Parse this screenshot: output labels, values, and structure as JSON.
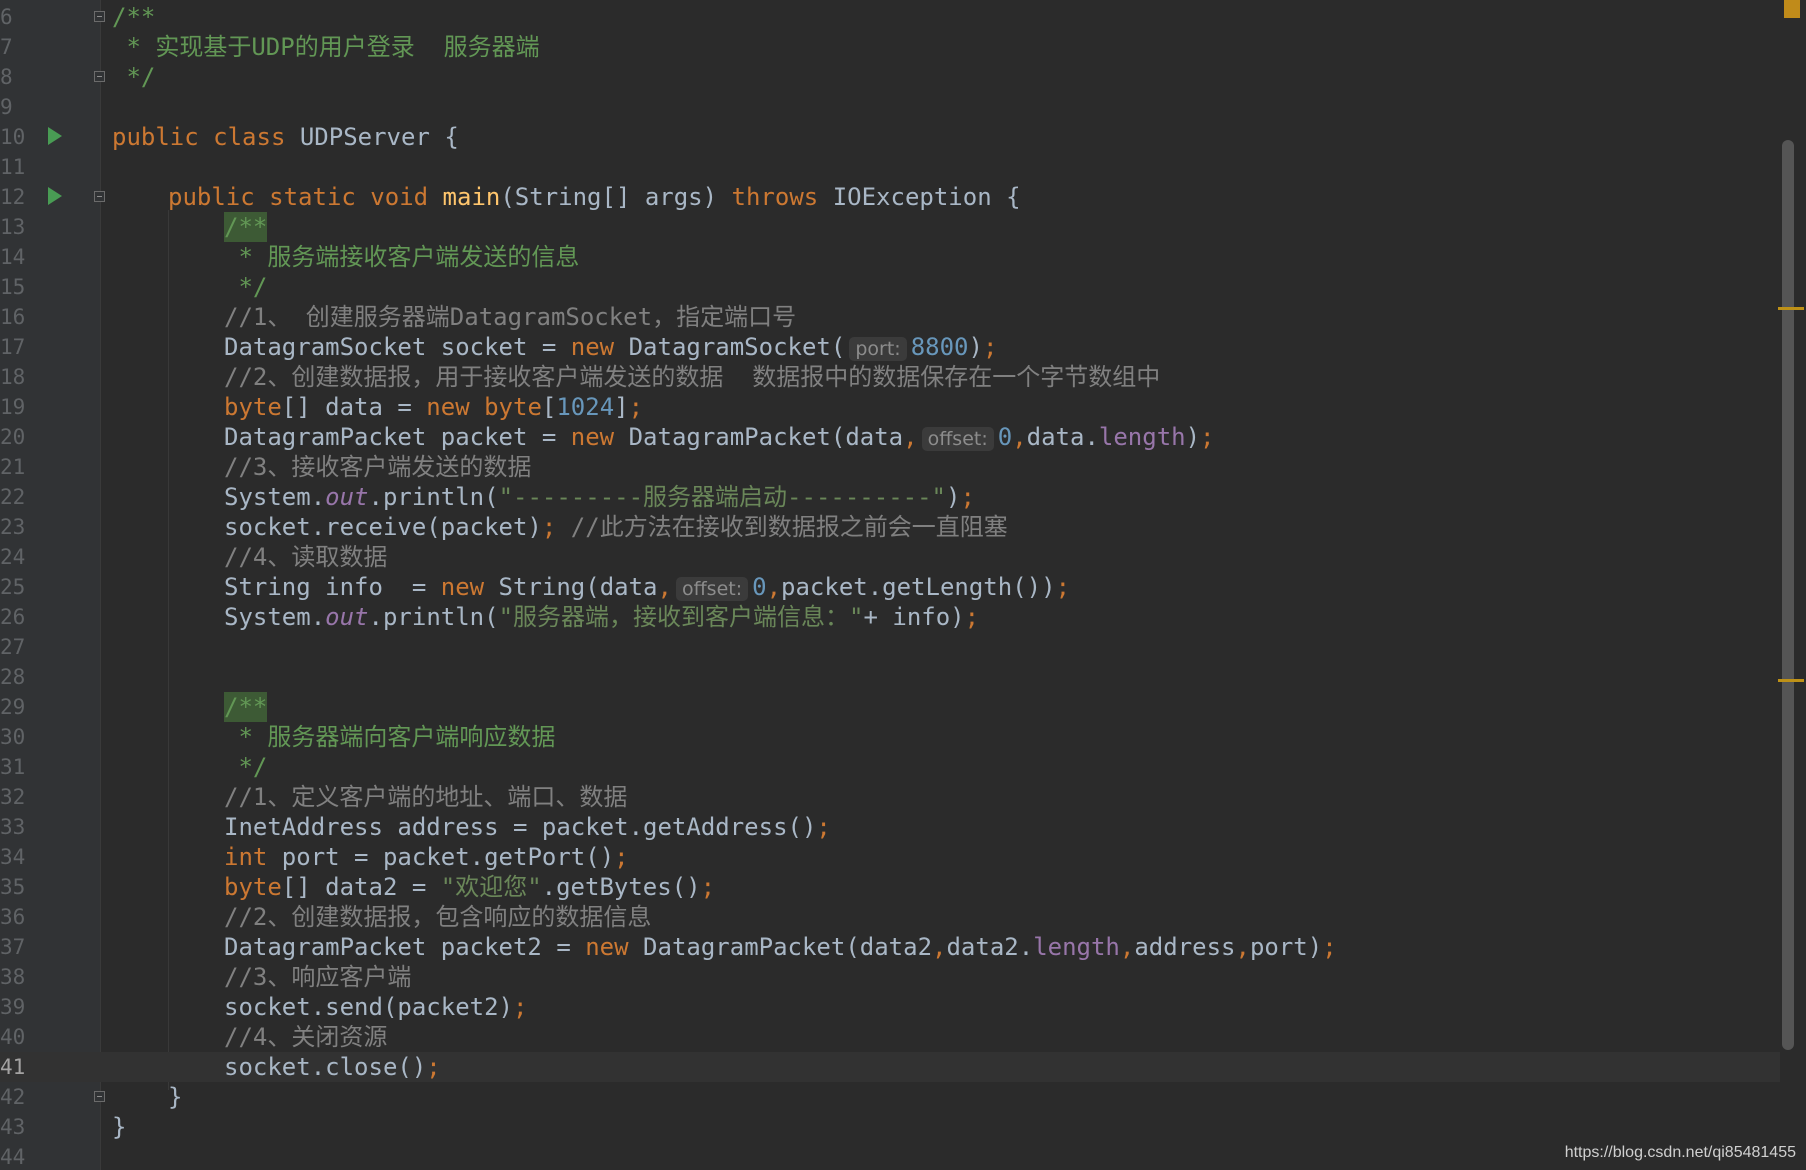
{
  "editor": {
    "watermark": "https://blog.csdn.net/qi85481455",
    "colors": {
      "background": "#2b2b2b",
      "keyword": "#cc7832",
      "comment": "#808080",
      "doc_comment": "#629755",
      "string": "#6a8759",
      "number": "#6897bb",
      "field": "#9876aa",
      "method_decl": "#ffc66d"
    },
    "line_numbers": [
      "6",
      "7",
      "8",
      "9",
      "10",
      "11",
      "12",
      "13",
      "14",
      "15",
      "16",
      "17",
      "18",
      "19",
      "20",
      "21",
      "22",
      "23",
      "24",
      "25",
      "26",
      "27",
      "28",
      "29",
      "30",
      "31",
      "32",
      "33",
      "34",
      "35",
      "36",
      "37",
      "38",
      "39",
      "40",
      "41",
      "42",
      "43",
      "44"
    ],
    "current_line": "41",
    "lines": {
      "l6": "/**",
      "l7": " * 实现基于UDP的用户登录  服务器端",
      "l8": " */",
      "l10": {
        "kw": "public class",
        "name": "UDPServer {"
      },
      "l12": {
        "kw1": "public static void",
        "fn": "main",
        "mid": "(String[] args)",
        "kw2": "throws",
        "rest": "IOException {"
      },
      "l13": "/**",
      "l14": " * 服务端接收客户端发送的信息",
      "l15": " */",
      "l16": "//1、 创建服务器端DatagramSocket，指定端口号",
      "l17": {
        "a": "DatagramSocket socket = ",
        "kw": "new",
        "b": " DatagramSocket(",
        "hint": "port:",
        "num": "8800",
        "c": ")",
        "semi": ";"
      },
      "l18": "//2、创建数据报，用于接收客户端发送的数据  数据报中的数据保存在一个字节数组中",
      "l19": {
        "kw": "byte",
        "a": "[] data = ",
        "kw2": "new",
        "kw3": "byte",
        "b": "[",
        "num": "1024",
        "c": "]",
        "semi": ";"
      },
      "l20": {
        "a": "DatagramPacket packet = ",
        "kw": "new",
        "b": " DatagramPacket(data",
        "comma": ",",
        "hint": "offset:",
        "num": "0",
        "comma2": ",",
        "c": "data.",
        "fld": "length",
        "d": ")",
        "semi": ";"
      },
      "l21": "//3、接收客户端发送的数据",
      "l22": {
        "a": "System.",
        "stat": "out",
        "b": ".println(",
        "str": "\"---------服务器端启动----------\"",
        "c": ")",
        "semi": ";"
      },
      "l23": {
        "a": "socket.receive(packet)",
        "semi": ";",
        "cm": " //此方法在接收到数据报之前会一直阻塞"
      },
      "l24": "//4、读取数据",
      "l25": {
        "a": "String info  = ",
        "kw": "new",
        "b": " String(data",
        "comma": ",",
        "hint": "offset:",
        "num": "0",
        "comma2": ",",
        "c": "packet.getLength())",
        "semi": ";"
      },
      "l26": {
        "a": "System.",
        "stat": "out",
        "b": ".println(",
        "str": "\"服务器端，接收到客户端信息：\"",
        "c": "+ info)",
        "semi": ";"
      },
      "l29": "/**",
      "l30": " * 服务器端向客户端响应数据",
      "l31": " */",
      "l32": "//1、定义客户端的地址、端口、数据",
      "l33": {
        "a": "InetAddress address = packet.getAddress()",
        "semi": ";"
      },
      "l34": {
        "kw": "int",
        "a": " port = packet.getPort()",
        "semi": ";"
      },
      "l35": {
        "kw": "byte",
        "a": "[] data2 = ",
        "str": "\"欢迎您\"",
        "b": ".getBytes()",
        "semi": ";"
      },
      "l36": "//2、创建数据报，包含响应的数据信息",
      "l37": {
        "a": "DatagramPacket packet2 = ",
        "kw": "new",
        "b": " DatagramPacket(data2",
        "comma": ",",
        "c": "data2.",
        "fld": "length",
        "comma2": ",",
        "d": "address",
        "comma3": ",",
        "e": "port)",
        "semi": ";"
      },
      "l38": "//3、响应客户端",
      "l39": {
        "a": "socket.send(packet2)",
        "semi": ";"
      },
      "l40": "//4、关闭资源",
      "l41": {
        "a": "socket.close()",
        "semi": ";"
      },
      "l42": "}",
      "l43": "}"
    }
  }
}
